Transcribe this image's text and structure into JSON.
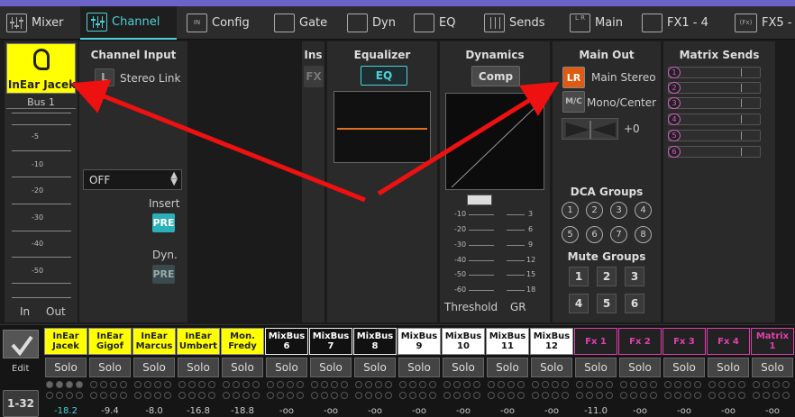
{
  "tabs": [
    {
      "label": "Mixer",
      "icon": "mixer-icon"
    },
    {
      "label": "Channel",
      "icon": "channel-icon",
      "active": true
    },
    {
      "label": "Config",
      "icon": "config-icon"
    },
    {
      "label": "Gate",
      "icon": "gate-icon"
    },
    {
      "label": "Dyn",
      "icon": "dyn-icon"
    },
    {
      "label": "EQ",
      "icon": "eq-icon"
    },
    {
      "label": "Sends",
      "icon": "sends-icon"
    },
    {
      "label": "Main",
      "icon": "main-icon"
    },
    {
      "label": "FX1 - 4",
      "icon": "fx-icon"
    },
    {
      "label": "FX5 -",
      "icon": "fx-icon"
    }
  ],
  "channel": {
    "name": "InEar Jacek",
    "bus": "Bus 1",
    "meter_ticks": [
      "-5",
      "-10",
      "-20",
      "-30",
      "-40",
      "-50"
    ],
    "in_label": "In",
    "out_label": "Out",
    "accent": "#ffff00"
  },
  "channel_input": {
    "title": "Channel Input",
    "link_btn": "L",
    "stereo_link": "Stereo Link",
    "select_value": "OFF",
    "insert_label": "Insert",
    "insert_btn": "PRE",
    "dyn_label": "Dyn.",
    "dyn_btn": "PRE"
  },
  "ins": {
    "title": "Ins",
    "fx": "FX"
  },
  "equalizer": {
    "title": "Equalizer",
    "btn": "EQ",
    "eq_line_color": "#e07020"
  },
  "dynamics": {
    "title": "Dynamics",
    "btn": "Comp",
    "threshold_ticks": [
      "-10",
      "-20",
      "-30",
      "-40",
      "-50",
      "-60"
    ],
    "gr_ticks": [
      "3",
      "6",
      "9",
      "12",
      "15",
      "18"
    ],
    "threshold_label": "Threshold",
    "gr_label": "GR"
  },
  "main_out": {
    "title": "Main Out",
    "lr_btn": "LR",
    "lr_label": "Main Stereo",
    "mc_btn": "M/C",
    "mc_label": "Mono/Center",
    "pan_value": "+0",
    "lr_color": "#e05a10"
  },
  "dca": {
    "title": "DCA Groups",
    "items": [
      "1",
      "2",
      "3",
      "4",
      "5",
      "6",
      "7",
      "8"
    ]
  },
  "mute": {
    "title": "Mute Groups",
    "items": [
      "1",
      "2",
      "3",
      "4",
      "5",
      "6"
    ]
  },
  "matrix": {
    "title": "Matrix Sends",
    "items": [
      "1",
      "2",
      "3",
      "4",
      "5",
      "6"
    ]
  },
  "bottom": {
    "edit_label": "Edit",
    "bank_label": "1-32"
  },
  "strips": [
    {
      "name": "InEar Jacek",
      "solo": "Solo",
      "gain": "-18.2",
      "type": "yellow"
    },
    {
      "name": "InEar Gigof",
      "solo": "Solo",
      "gain": "-9.4",
      "type": "yellow"
    },
    {
      "name": "InEar Marcus",
      "solo": "Solo",
      "gain": "-8.0",
      "type": "yellow"
    },
    {
      "name": "InEar Umbert",
      "solo": "Solo",
      "gain": "-16.8",
      "type": "yellow"
    },
    {
      "name": "Mon. Fredy",
      "solo": "Solo",
      "gain": "-18.8",
      "type": "yellow"
    },
    {
      "name": "MixBus 6",
      "solo": "Solo",
      "gain": "-oo",
      "type": "black"
    },
    {
      "name": "MixBus 7",
      "solo": "Solo",
      "gain": "-oo",
      "type": "black"
    },
    {
      "name": "MixBus 8",
      "solo": "Solo",
      "gain": "-oo",
      "type": "black"
    },
    {
      "name": "MixBus 9",
      "solo": "Solo",
      "gain": "-oo",
      "type": "white"
    },
    {
      "name": "MixBus 10",
      "solo": "Solo",
      "gain": "-oo",
      "type": "white"
    },
    {
      "name": "MixBus 11",
      "solo": "Solo",
      "gain": "-oo",
      "type": "white"
    },
    {
      "name": "MixBus 12",
      "solo": "Solo",
      "gain": "-oo",
      "type": "white"
    },
    {
      "name": "Fx 1",
      "solo": "Solo",
      "gain": "-11.0",
      "type": "fx"
    },
    {
      "name": "Fx 2",
      "solo": "Solo",
      "gain": "-oo",
      "type": "fx"
    },
    {
      "name": "Fx 3",
      "solo": "Solo",
      "gain": "-oo",
      "type": "fx"
    },
    {
      "name": "Fx 4",
      "solo": "Solo",
      "gain": "-oo",
      "type": "fx"
    },
    {
      "name": "Matrix 1",
      "solo": "Solo",
      "gain": "-oo",
      "type": "fx"
    }
  ]
}
